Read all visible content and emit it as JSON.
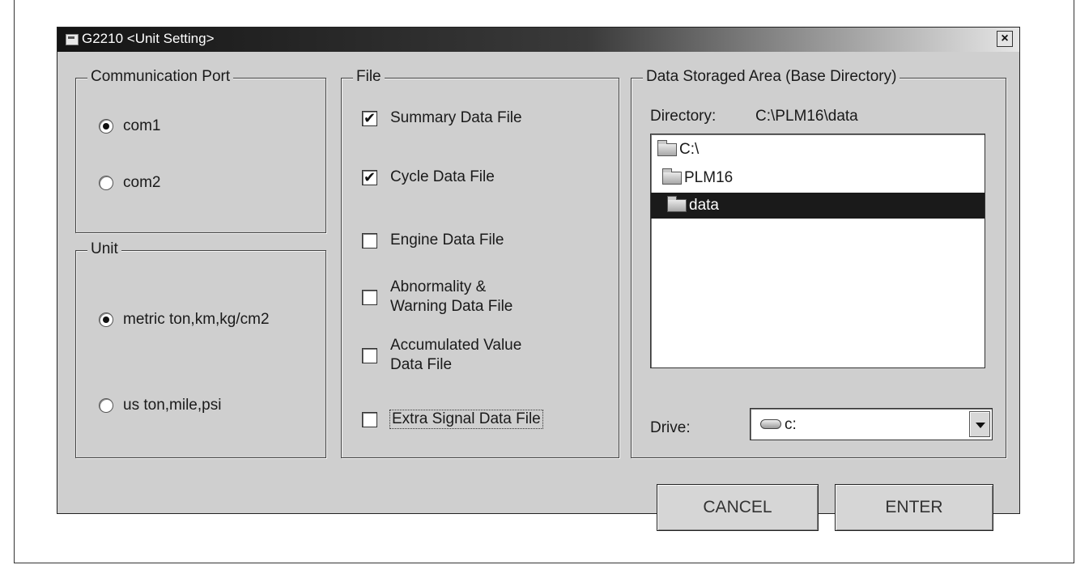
{
  "window": {
    "title": "G2210 <Unit Setting>",
    "close_label": "×"
  },
  "communication_port": {
    "legend": "Communication Port",
    "options": [
      {
        "label": "com1",
        "selected": true
      },
      {
        "label": "com2",
        "selected": false
      }
    ]
  },
  "unit": {
    "legend": "Unit",
    "options": [
      {
        "label": "metric ton,km,kg/cm2",
        "selected": true
      },
      {
        "label": "us ton,mile,psi",
        "selected": false
      }
    ]
  },
  "file": {
    "legend": "File",
    "options": [
      {
        "label": "Summary Data File",
        "checked": true
      },
      {
        "label": "Cycle Data File",
        "checked": true
      },
      {
        "label": "Engine Data File",
        "checked": false
      },
      {
        "label_line1": "Abnormality &",
        "label_line2": "Warning Data File",
        "checked": false
      },
      {
        "label_line1": "Accumulated Value",
        "label_line2": "Data File",
        "checked": false
      },
      {
        "label": "Extra Signal Data File",
        "checked": false
      }
    ]
  },
  "data_area": {
    "legend": "Data Storaged Area (Base Directory)",
    "directory_label": "Directory:",
    "directory_value": "C:\\PLM16\\data",
    "tree": [
      {
        "label": "C:\\",
        "selected": false
      },
      {
        "label": "PLM16",
        "selected": false
      },
      {
        "label": "data",
        "selected": true
      }
    ],
    "drive_label": "Drive:",
    "drive_value": "c:"
  },
  "buttons": {
    "cancel": "CANCEL",
    "enter": "ENTER"
  },
  "checkmark": "✔"
}
